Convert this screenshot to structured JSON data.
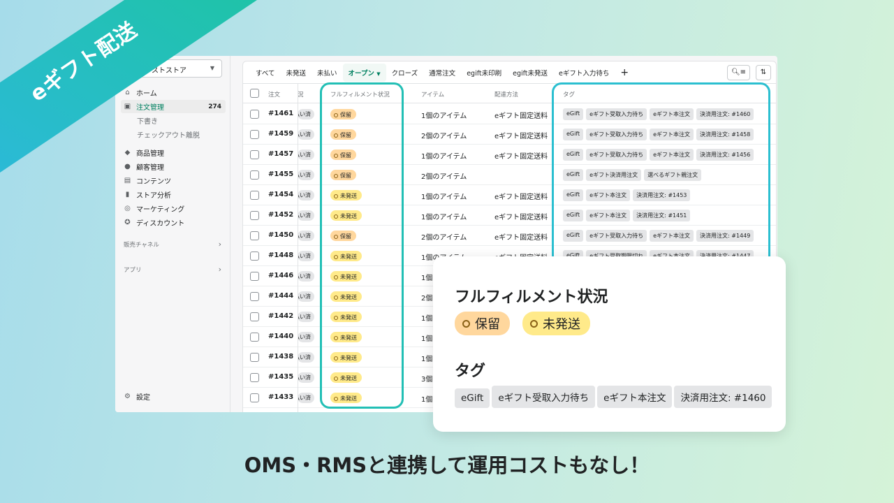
{
  "banner": {
    "text": "eギフト配送",
    "color": "#2bbfc6"
  },
  "sidebar": {
    "store_name": "_テストストア",
    "items": [
      {
        "label": "ホーム",
        "icon": "home-icon"
      },
      {
        "label": "注文管理",
        "icon": "orders-icon",
        "count": "274",
        "active": true
      },
      {
        "label": "商品管理",
        "icon": "tag-icon"
      },
      {
        "label": "顧客管理",
        "icon": "person-icon"
      },
      {
        "label": "コンテンツ",
        "icon": "content-icon"
      },
      {
        "label": "ストア分析",
        "icon": "chart-bar-icon"
      },
      {
        "label": "マーケティング",
        "icon": "marketing-icon"
      },
      {
        "label": "ディスカウント",
        "icon": "discount-icon"
      }
    ],
    "sub_items": [
      "下書き",
      "チェックアウト離脱"
    ],
    "sections": [
      "販売チャネル",
      "アプリ"
    ],
    "settings": "設定"
  },
  "tabs": [
    "すべて",
    "未発送",
    "未払い",
    "オープン",
    "クローズ",
    "通常注文",
    "egift未印刷",
    "egift未発送",
    "eギフト入力待ち"
  ],
  "selected_tab": "オープン",
  "table": {
    "headers": {
      "order": "注文",
      "payment": "況",
      "fulfillment": "フルフィルメント状況",
      "items": "アイテム",
      "delivery": "配達方法",
      "tags": "タグ"
    },
    "payment_label": "払い済",
    "status_colors": {
      "保留": "#ffd79d",
      "未発送": "#ffea8a"
    },
    "rows": [
      {
        "order": "#1461",
        "status": "保留",
        "items": "1個のアイテム",
        "delivery": "eギフト固定送料",
        "tags": [
          "eGift",
          "eギフト受取入力待ち",
          "eギフト本注文",
          "決済用注文: #1460"
        ]
      },
      {
        "order": "#1459",
        "status": "保留",
        "items": "2個のアイテム",
        "delivery": "eギフト固定送料",
        "tags": [
          "eGift",
          "eギフト受取入力待ち",
          "eギフト本注文",
          "決済用注文: #1458"
        ]
      },
      {
        "order": "#1457",
        "status": "保留",
        "items": "1個のアイテム",
        "delivery": "eギフト固定送料",
        "tags": [
          "eGift",
          "eギフト受取入力待ち",
          "eギフト本注文",
          "決済用注文: #1456"
        ]
      },
      {
        "order": "#1455",
        "status": "保留",
        "items": "2個のアイテム",
        "delivery": "",
        "tags": [
          "eGift",
          "eギフト決済用注文",
          "選べるギフト親注文"
        ]
      },
      {
        "order": "#1454",
        "status": "未発送",
        "items": "1個のアイテム",
        "delivery": "eギフト固定送料",
        "tags": [
          "eGift",
          "eギフト本注文",
          "決済用注文: #1453"
        ]
      },
      {
        "order": "#1452",
        "status": "未発送",
        "items": "1個のアイテム",
        "delivery": "eギフト固定送料",
        "tags": [
          "eGift",
          "eギフト本注文",
          "決済用注文: #1451"
        ]
      },
      {
        "order": "#1450",
        "status": "保留",
        "items": "2個のアイテム",
        "delivery": "eギフト固定送料",
        "tags": [
          "eGift",
          "eギフト受取入力待ち",
          "eギフト本注文",
          "決済用注文: #1449"
        ]
      },
      {
        "order": "#1448",
        "status": "未発送",
        "items": "1個のアイテム",
        "delivery": "eギフト固定送料",
        "tags": [
          "eGift",
          "eギフト受取期限切れ",
          "eギフト本注文",
          "決済用注文: #1447"
        ]
      },
      {
        "order": "#1446",
        "status": "未発送",
        "items": "1個",
        "delivery": "",
        "tags": []
      },
      {
        "order": "#1444",
        "status": "未発送",
        "items": "2個",
        "delivery": "",
        "tags": []
      },
      {
        "order": "#1442",
        "status": "未発送",
        "items": "1個",
        "delivery": "",
        "tags": []
      },
      {
        "order": "#1440",
        "status": "未発送",
        "items": "1個",
        "delivery": "",
        "tags": []
      },
      {
        "order": "#1438",
        "status": "未発送",
        "items": "1個",
        "delivery": "",
        "tags": []
      },
      {
        "order": "#1435",
        "status": "未発送",
        "items": "3個",
        "delivery": "",
        "tags": []
      },
      {
        "order": "#1433",
        "status": "未発送",
        "items": "1個",
        "delivery": "",
        "tags": []
      }
    ]
  },
  "highlight_color": "#22bfb5",
  "popup": {
    "fulfillment_title": "フルフィルメント状況",
    "statuses": [
      "保留",
      "未発送"
    ],
    "tags_title": "タグ",
    "tags": [
      "eGift",
      "eギフト受取入力待ち",
      "eギフト本注文",
      "決済用注文: #1460"
    ]
  },
  "footer": "OMS・RMSと連携して運用コストもなし！"
}
